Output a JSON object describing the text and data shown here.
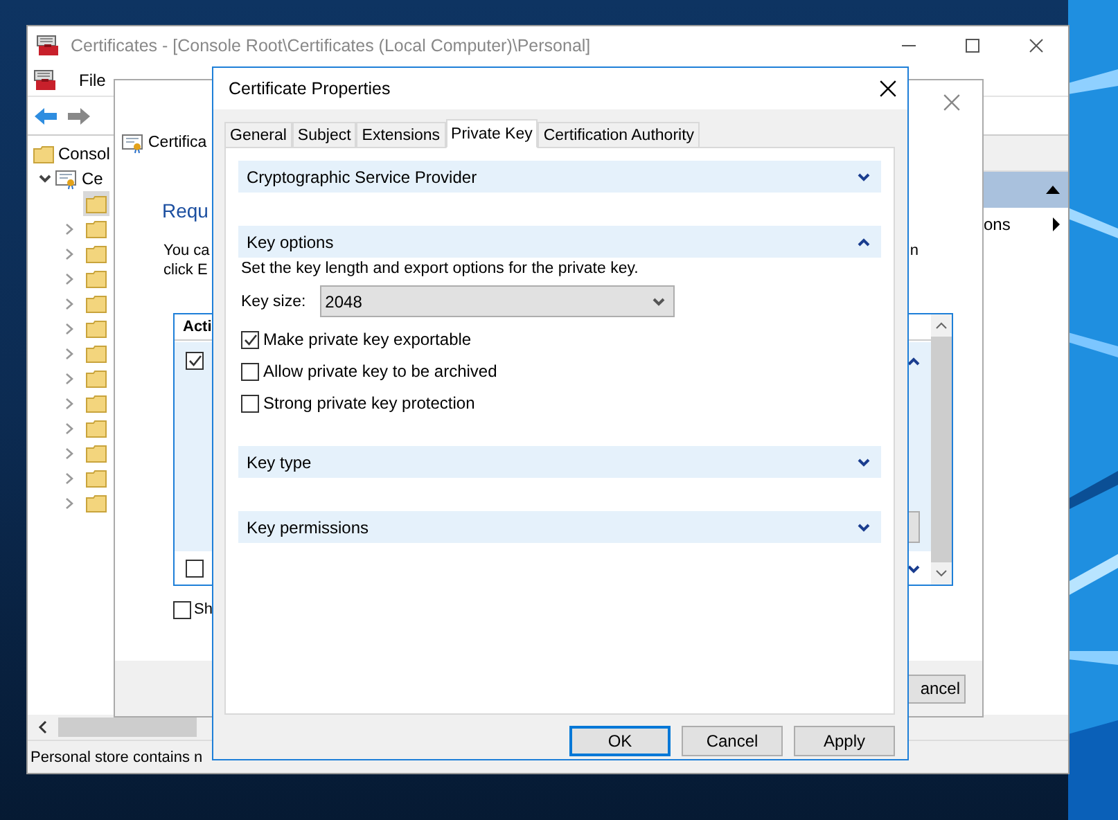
{
  "console_window": {
    "title": "Certificates - [Console Root\\Certificates (Local Computer)\\Personal]",
    "menu": [
      "File"
    ],
    "tree": {
      "label": "Consol",
      "children": [
        {
          "label": "Ce",
          "expanded": true,
          "folders": [
            {
              "selected": true,
              "has_children": false
            },
            {
              "selected": false,
              "has_children": true
            },
            {
              "selected": false,
              "has_children": true
            },
            {
              "selected": false,
              "has_children": true
            },
            {
              "selected": false,
              "has_children": true
            },
            {
              "selected": false,
              "has_children": true
            },
            {
              "selected": false,
              "has_children": true
            },
            {
              "selected": false,
              "has_children": true
            },
            {
              "selected": false,
              "has_children": true
            },
            {
              "selected": false,
              "has_children": true
            },
            {
              "selected": false,
              "has_children": true
            },
            {
              "selected": false,
              "has_children": true
            },
            {
              "selected": false,
              "has_children": true
            }
          ]
        }
      ]
    },
    "actions_pane": {
      "header_expanded": true,
      "item": "ons"
    },
    "status_bar": "Personal store contains n"
  },
  "wizard": {
    "title": "Certifica",
    "heading": "Requ",
    "text_lines": [
      "You ca",
      "click E"
    ],
    "text_right": "n",
    "list": {
      "header": "Acti",
      "row": {
        "checked": true,
        "expanded": true
      },
      "bottom_row": {
        "checked": false
      }
    },
    "show_all": {
      "label": "Sh",
      "checked": false
    },
    "button": "ancel"
  },
  "dialog": {
    "title": "Certificate Properties",
    "tabs": [
      {
        "label": "General",
        "selected": false
      },
      {
        "label": "Subject",
        "selected": false
      },
      {
        "label": "Extensions",
        "selected": false
      },
      {
        "label": "Private Key",
        "selected": true
      },
      {
        "label": "Certification Authority",
        "selected": false
      }
    ],
    "sections": [
      {
        "title": "Cryptographic Service Provider",
        "expanded": false
      },
      {
        "title": "Key options",
        "expanded": true,
        "description": "Set the key length and export options for the private key.",
        "key_size": {
          "label": "Key size:",
          "value": "2048"
        },
        "options": [
          {
            "label": "Make private key exportable",
            "checked": true
          },
          {
            "label": "Allow private key to be archived",
            "checked": false
          },
          {
            "label": "Strong private key protection",
            "checked": false
          }
        ]
      },
      {
        "title": "Key type",
        "expanded": false
      },
      {
        "title": "Key permissions",
        "expanded": false
      }
    ],
    "buttons": [
      {
        "label": "OK",
        "default": true
      },
      {
        "label": "Cancel",
        "default": false
      },
      {
        "label": "Apply",
        "default": false
      }
    ]
  }
}
